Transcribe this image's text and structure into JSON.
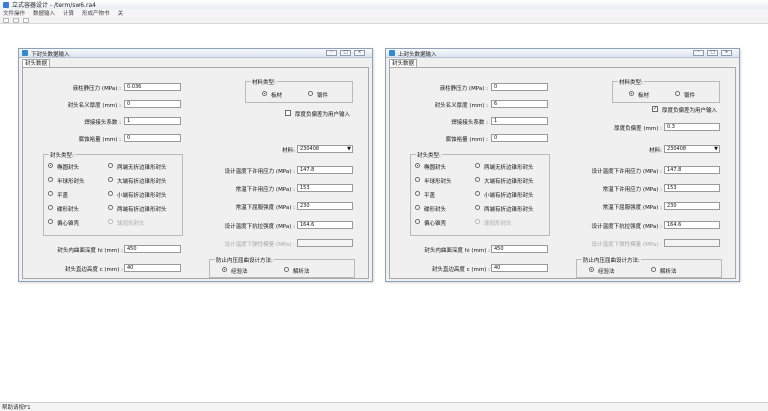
{
  "app": {
    "title": "立式容器设计 - /term/sw6.ra4",
    "menu": [
      "文件操作",
      "数据输入",
      "计算",
      "形成产物书",
      "关"
    ],
    "status": "帮助请按F1"
  },
  "left": {
    "title": "下封头数据输入",
    "tab": "封头数据",
    "fields": {
      "pressure": {
        "label": "液柱静压力 (MPa) :",
        "value": "0.036"
      },
      "thickness": {
        "label": "封头名义厚度 (mm) :",
        "value": "0"
      },
      "weld_coef": {
        "label": "焊接接头系数 :",
        "value": "1"
      },
      "corrosion": {
        "label": "腐蚀裕量 (mm) :",
        "value": "0"
      }
    },
    "material_type": {
      "caption": "材料类型:",
      "plate": "板材",
      "forging": "锻件"
    },
    "neg_dev": {
      "label": "厚度负偏差为用户输入",
      "checked": false
    },
    "material": {
      "label": "材料:",
      "value": "230408"
    },
    "props": {
      "design_stress": {
        "label": "设计温度下许用应力 (MPa) :",
        "value": "147.8"
      },
      "room_stress": {
        "label": "常温下许用应力 (MPa) :",
        "value": "153"
      },
      "yield": {
        "label": "常温下屈服强度 (MPa) :",
        "value": "230"
      },
      "tensile": {
        "label": "设计温度下抗拉强度 (MPa) :",
        "value": "164.6"
      },
      "elastic": {
        "label": "设计温度下弹性模量 (MPa) :",
        "value": ""
      }
    },
    "head_type": {
      "caption": "封头类型:",
      "items": [
        "椭圆封头",
        "半球形封头",
        "平盖",
        "碟形封头",
        "偏心锥壳",
        "两端无折边锥形封头",
        "大端有折边锥形封头",
        "小端有折边锥形封头",
        "两端有折边锥形封头",
        "球冠形封头"
      ]
    },
    "depth": {
      "label": "封头内曲面深度 hi (mm) :",
      "value": "450"
    },
    "straight": {
      "label": "封头直边高度 c (mm) :",
      "value": "40"
    },
    "method": {
      "caption": "防止内压屈曲设计方法:",
      "a": "经验法",
      "b": "解析法"
    }
  },
  "right": {
    "title": "上封头数据输入",
    "tab": "封头数据",
    "fields": {
      "pressure": {
        "label": "液柱静压力 (MPa) :",
        "value": "0"
      },
      "thickness": {
        "label": "封头名义厚度 (mm) :",
        "value": "6"
      },
      "weld_coef": {
        "label": "焊接接头系数 :",
        "value": "1"
      },
      "corrosion": {
        "label": "腐蚀裕量 (mm) :",
        "value": "0"
      }
    },
    "material_type": {
      "caption": "材料类型:",
      "plate": "板材",
      "forging": "锻件"
    },
    "neg_dev": {
      "label": "厚度负偏差为用户输入",
      "checked": true,
      "value_label": "厚度负偏差 (mm) :",
      "value": "0.3"
    },
    "material": {
      "label": "材料:",
      "value": "230408"
    },
    "props": {
      "design_stress": {
        "label": "设计温度下许用应力 (MPa) :",
        "value": "147.8"
      },
      "room_stress": {
        "label": "常温下许用应力 (MPa) :",
        "value": "153"
      },
      "yield": {
        "label": "常温下屈服强度 (MPa) :",
        "value": "230"
      },
      "tensile": {
        "label": "设计温度下抗拉强度 (MPa) :",
        "value": "164.6"
      },
      "elastic": {
        "label": "设计温度下弹性模量 (MPa) :",
        "value": ""
      }
    },
    "head_type": {
      "caption": "封头类型:",
      "items": [
        "椭圆封头",
        "半球形封头",
        "平盖",
        "碟形封头",
        "偏心锥壳",
        "两端无折边锥形封头",
        "大端有折边锥形封头",
        "小端有折边锥形封头",
        "两端有折边锥形封头",
        "球冠形封头"
      ]
    },
    "depth": {
      "label": "封头内曲面深度 hi (mm) :",
      "value": "450"
    },
    "straight": {
      "label": "封头直边高度 c (mm) :",
      "value": "40"
    },
    "method": {
      "caption": "防止内压屈曲设计方法:",
      "a": "经验法",
      "b": "解析法"
    }
  }
}
